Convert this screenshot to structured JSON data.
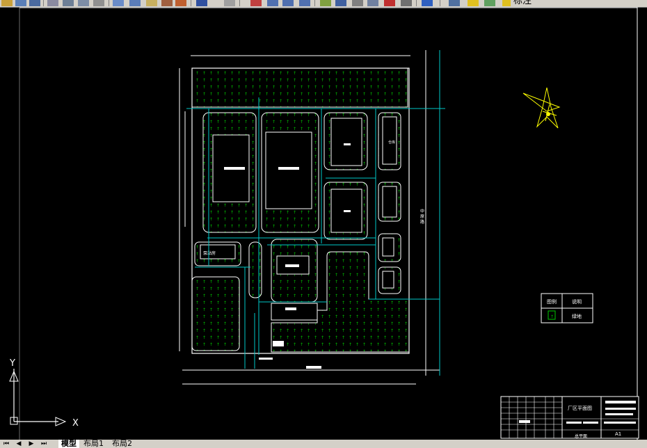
{
  "toolbar": {
    "items": [
      "open-icon",
      "save-icon",
      "cut-icon",
      "copy-icon",
      "paste-icon",
      "zoom-realtime-icon",
      "zoom-window-icon",
      "zoom-previous-icon",
      "zoom-extents-icon",
      "properties-icon",
      "design-center-icon",
      "tool-palette-icon",
      "markup-icon",
      "calculator-icon",
      "layer-icon",
      "color-icon"
    ],
    "text_style_label": "标注"
  },
  "drawing": {
    "outside_height_label": "",
    "road_label_vertical": "中 原 路",
    "buildings": {
      "b1_label": "",
      "b2_label": "",
      "b3_label": "",
      "small_hut_label": "泵站房",
      "east_building_label": "仓库"
    },
    "legend": {
      "header_symbol": "图例",
      "header_desc": "说明",
      "row_desc": "绿地"
    },
    "title_block": {
      "title": "厂区平面图",
      "sheet_no": "A1",
      "footer": "总平面"
    }
  },
  "ucs": {
    "x_label": "X",
    "y_label": "Y"
  },
  "tabs": {
    "model": "模型",
    "layout1": "布局1",
    "layout2": "布局2"
  },
  "colors": {
    "outline": "#ffffff",
    "center_line": "#00c8c8",
    "grass": "#00c800",
    "north_arrow": "#ffff00",
    "background": "#000000"
  }
}
